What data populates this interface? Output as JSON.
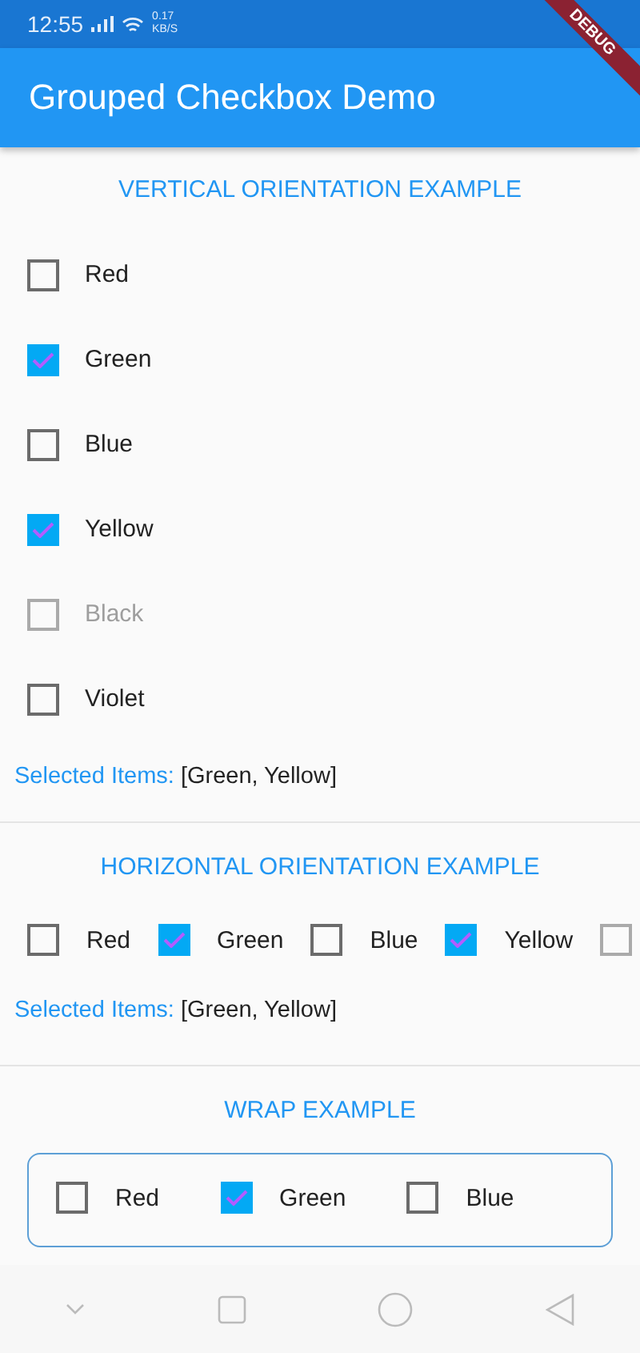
{
  "status_bar": {
    "time": "12:55",
    "speed_value": "0.17",
    "speed_unit": "KB/S"
  },
  "debug_banner": "DEBUG",
  "app_bar": {
    "title": "Grouped Checkbox Demo"
  },
  "sections": [
    {
      "kind": "vertical",
      "title": "VERTICAL ORIENTATION EXAMPLE",
      "items": [
        {
          "label": "Red",
          "checked": false,
          "disabled": false
        },
        {
          "label": "Green",
          "checked": true,
          "disabled": false
        },
        {
          "label": "Blue",
          "checked": false,
          "disabled": false
        },
        {
          "label": "Yellow",
          "checked": true,
          "disabled": false
        },
        {
          "label": "Black",
          "checked": false,
          "disabled": true
        },
        {
          "label": "Violet",
          "checked": false,
          "disabled": false
        }
      ],
      "selected_label": "Selected Items:",
      "selected_value": "[Green, Yellow]"
    },
    {
      "kind": "horizontal",
      "title": "HORIZONTAL ORIENTATION EXAMPLE",
      "items": [
        {
          "label": "Red",
          "checked": false,
          "disabled": false
        },
        {
          "label": "Green",
          "checked": true,
          "disabled": false
        },
        {
          "label": "Blue",
          "checked": false,
          "disabled": false
        },
        {
          "label": "Yellow",
          "checked": true,
          "disabled": false
        },
        {
          "checked": false,
          "disabled": true
        }
      ],
      "selected_label": "Selected Items:",
      "selected_value": "[Green, Yellow]"
    },
    {
      "kind": "wrap",
      "title": "WRAP EXAMPLE",
      "items": [
        {
          "label": "Red",
          "checked": false,
          "disabled": false
        },
        {
          "label": "Green",
          "checked": true,
          "disabled": false
        },
        {
          "label": "Blue",
          "checked": false,
          "disabled": false
        }
      ]
    }
  ]
}
